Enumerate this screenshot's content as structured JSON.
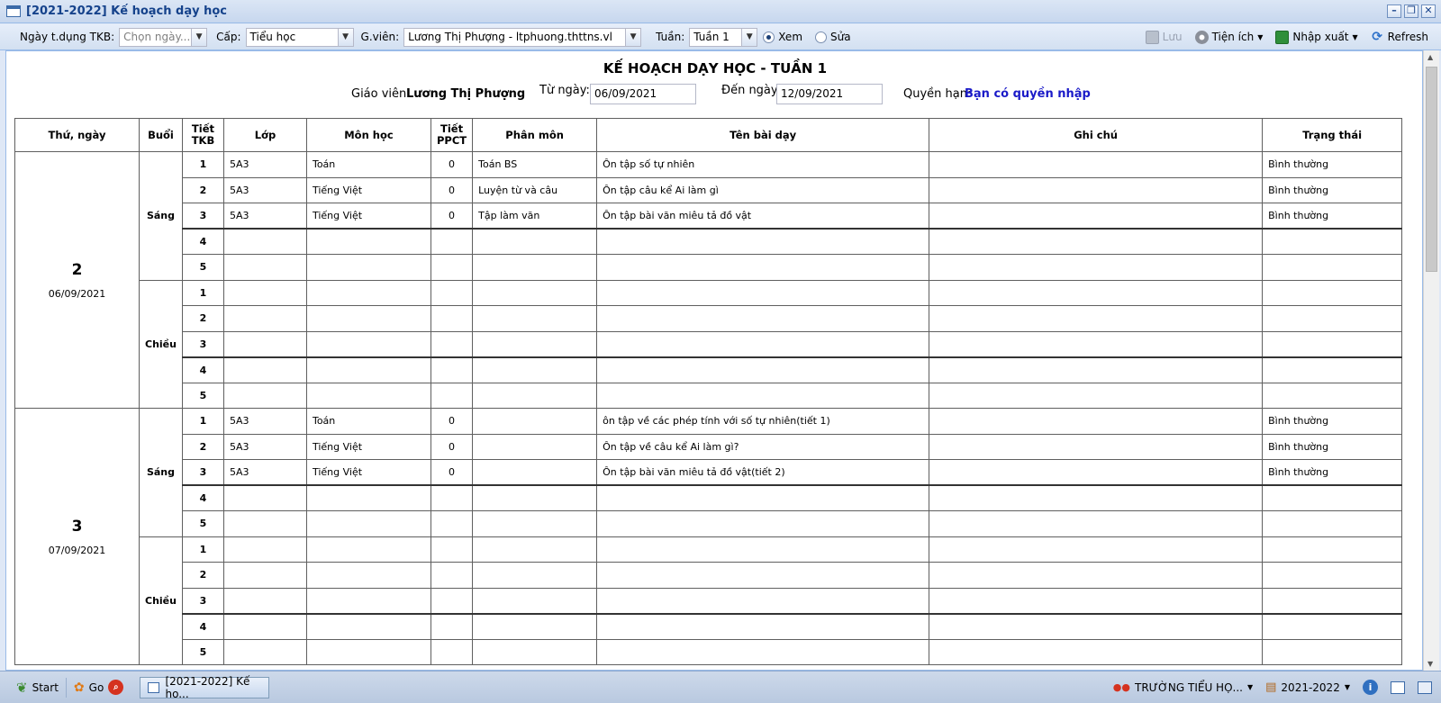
{
  "window": {
    "title": "[2021-2022] Kế hoạch dạy học"
  },
  "toolbar": {
    "date_label": "Ngày t.dụng TKB:",
    "date_placeholder": "Chọn ngày...",
    "level_label": "Cấp:",
    "level_value": "Tiểu học",
    "teacher_label": "G.viên:",
    "teacher_value": "Lương Thị Phượng - ltphuong.thttns.vl",
    "week_label": "Tuần:",
    "week_value": "Tuần 1",
    "radio_view": "Xem",
    "radio_edit": "Sửa",
    "save": "Lưu",
    "utilities": "Tiện ích",
    "import_export": "Nhập xuất",
    "refresh": "Refresh"
  },
  "header": {
    "title": "KẾ HOẠCH DẠY HỌC - TUẦN 1",
    "teacher_label": "Giáo viên:",
    "teacher_name": "Lương Thị Phượng",
    "from_label": "Từ ngày:",
    "from_value": "06/09/2021",
    "to_label": "Đến ngày:",
    "to_value": "12/09/2021",
    "perm_label": "Quyền hạn:",
    "perm_value": "Bạn có quyền nhập"
  },
  "columns": [
    "Thứ, ngày",
    "Buổi",
    "Tiết\nTKB",
    "Lớp",
    "Môn học",
    "Tiết\nPPCT",
    "Phân môn",
    "Tên bài dạy",
    "Ghi chú",
    "Trạng thái"
  ],
  "days": [
    {
      "day": "2",
      "date": "06/09/2021",
      "sessions": [
        {
          "name": "Sáng",
          "periods": [
            {
              "p": "1",
              "cls": "5A3",
              "subject": "Toán",
              "ppct": "0",
              "sub": "Toán BS",
              "lesson": "Ôn tập số tự nhiên",
              "note": "",
              "status": "Bình thường"
            },
            {
              "p": "2",
              "cls": "5A3",
              "subject": "Tiếng Việt",
              "ppct": "0",
              "sub": "Luyện từ và câu",
              "lesson": "Ôn tập câu kể Ai làm gì",
              "note": "",
              "status": "Bình thường"
            },
            {
              "p": "3",
              "cls": "5A3",
              "subject": "Tiếng Việt",
              "ppct": "0",
              "sub": "Tập làm văn",
              "lesson": "Ôn tập bài văn miêu tả đồ vật",
              "note": "",
              "status": "Bình thường"
            },
            {
              "p": "4",
              "cls": "",
              "subject": "",
              "ppct": "",
              "sub": "",
              "lesson": "",
              "note": "",
              "status": ""
            },
            {
              "p": "5",
              "cls": "",
              "subject": "",
              "ppct": "",
              "sub": "",
              "lesson": "",
              "note": "",
              "status": ""
            }
          ]
        },
        {
          "name": "Chiều",
          "periods": [
            {
              "p": "1",
              "cls": "",
              "subject": "",
              "ppct": "",
              "sub": "",
              "lesson": "",
              "note": "",
              "status": ""
            },
            {
              "p": "2",
              "cls": "",
              "subject": "",
              "ppct": "",
              "sub": "",
              "lesson": "",
              "note": "",
              "status": ""
            },
            {
              "p": "3",
              "cls": "",
              "subject": "",
              "ppct": "",
              "sub": "",
              "lesson": "",
              "note": "",
              "status": ""
            },
            {
              "p": "4",
              "cls": "",
              "subject": "",
              "ppct": "",
              "sub": "",
              "lesson": "",
              "note": "",
              "status": ""
            },
            {
              "p": "5",
              "cls": "",
              "subject": "",
              "ppct": "",
              "sub": "",
              "lesson": "",
              "note": "",
              "status": ""
            }
          ]
        }
      ]
    },
    {
      "day": "3",
      "date": "07/09/2021",
      "sessions": [
        {
          "name": "Sáng",
          "periods": [
            {
              "p": "1",
              "cls": "5A3",
              "subject": "Toán",
              "ppct": "0",
              "sub": "",
              "lesson": "ôn tập về các phép tính với số tự nhiên(tiết 1)",
              "note": "",
              "status": "Bình thường"
            },
            {
              "p": "2",
              "cls": "5A3",
              "subject": "Tiếng Việt",
              "ppct": "0",
              "sub": "",
              "lesson": "Ôn tập về câu kể Ai làm gì?",
              "note": "",
              "status": "Bình thường"
            },
            {
              "p": "3",
              "cls": "5A3",
              "subject": "Tiếng Việt",
              "ppct": "0",
              "sub": "",
              "lesson": "Ôn tập bài văn miêu tả đồ vật(tiết 2)",
              "note": "",
              "status": "Bình thường"
            },
            {
              "p": "4",
              "cls": "",
              "subject": "",
              "ppct": "",
              "sub": "",
              "lesson": "",
              "note": "",
              "status": ""
            },
            {
              "p": "5",
              "cls": "",
              "subject": "",
              "ppct": "",
              "sub": "",
              "lesson": "",
              "note": "",
              "status": ""
            }
          ]
        },
        {
          "name": "Chiều",
          "periods": [
            {
              "p": "1",
              "cls": "",
              "subject": "",
              "ppct": "",
              "sub": "",
              "lesson": "",
              "note": "",
              "status": ""
            },
            {
              "p": "2",
              "cls": "",
              "subject": "",
              "ppct": "",
              "sub": "",
              "lesson": "",
              "note": "",
              "status": ""
            },
            {
              "p": "3",
              "cls": "",
              "subject": "",
              "ppct": "",
              "sub": "",
              "lesson": "",
              "note": "",
              "status": ""
            },
            {
              "p": "4",
              "cls": "",
              "subject": "",
              "ppct": "",
              "sub": "",
              "lesson": "",
              "note": "",
              "status": ""
            },
            {
              "p": "5",
              "cls": "",
              "subject": "",
              "ppct": "",
              "sub": "",
              "lesson": "",
              "note": "",
              "status": ""
            }
          ]
        }
      ]
    }
  ],
  "taskbar": {
    "start": "Start",
    "go": "Go",
    "task": "[2021-2022] Kế ho...",
    "school": "TRƯỜNG TIỂU HỌ...",
    "year": "2021-2022"
  },
  "colors": {
    "title_text": "#15428b",
    "permission": "#1a1ac8",
    "border": "#99bbe8"
  }
}
